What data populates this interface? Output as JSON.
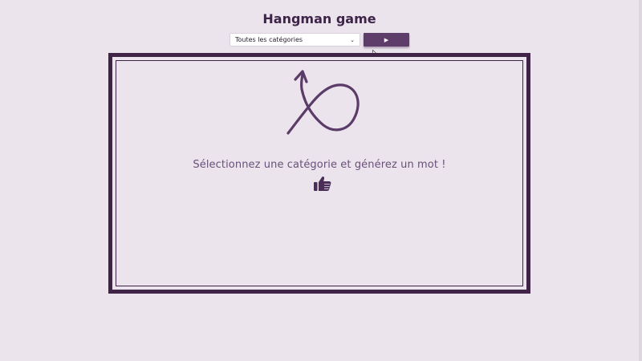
{
  "page": {
    "title": "Hangman game"
  },
  "controls": {
    "category_select": {
      "selected": "Toutes les catégories"
    },
    "play_button": {
      "icon": "play-icon",
      "symbol": "▶"
    }
  },
  "board": {
    "message": "Sélectionnez une catégorie et générez un mot !",
    "icons": [
      "squiggle-arrow-icon",
      "thumbs-up-icon"
    ]
  },
  "colors": {
    "background": "#ebe4ed",
    "accent": "#5e3d6b",
    "board_border": "#3f2448",
    "text": "#6a4f77",
    "title": "#3d2448"
  }
}
